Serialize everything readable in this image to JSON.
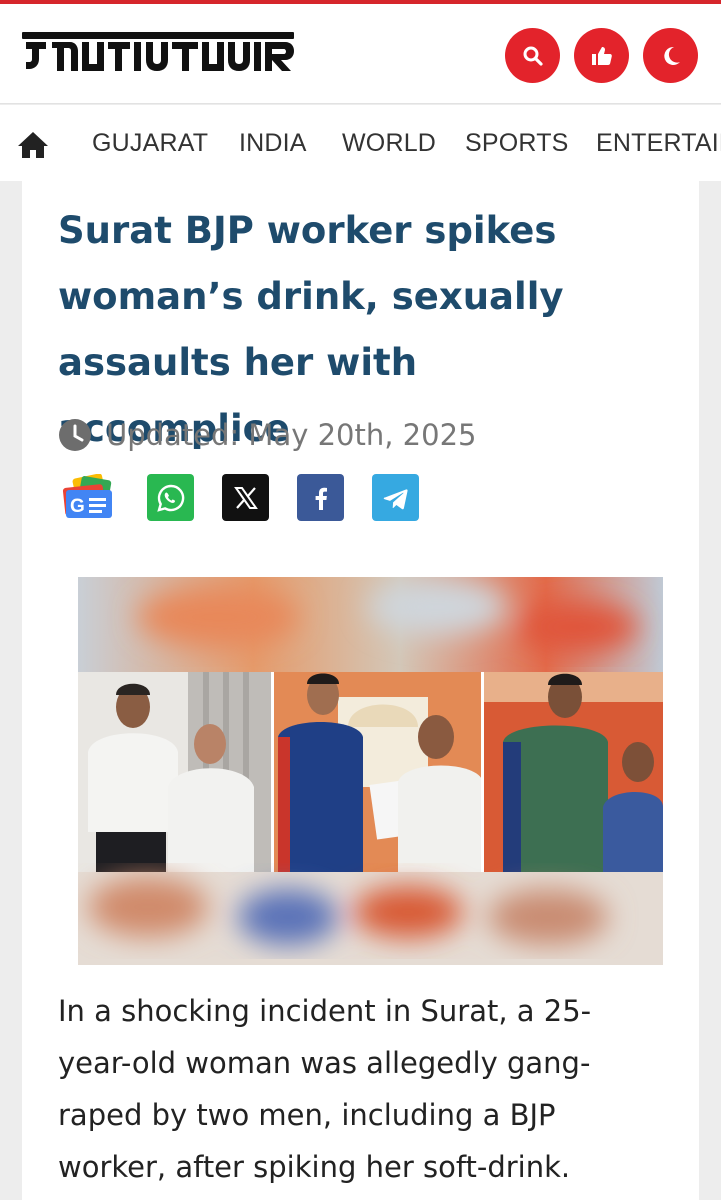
{
  "header": {
    "logo_text": "ગુજરાત સમાચાર",
    "search_icon": "search-icon",
    "like_icon": "thumbs-up-icon",
    "dark_mode_icon": "moon-icon",
    "accent_color": "#e3232b"
  },
  "nav": {
    "home_icon": "home-icon",
    "items": [
      "GUJARAT",
      "INDIA",
      "WORLD",
      "SPORTS",
      "ENTERTAIN"
    ]
  },
  "article": {
    "headline": "Surat BJP worker spikes woman’s drink, sexually assaults her with accomplice",
    "updated": "Updated: May 20th, 2025",
    "share": [
      {
        "name": "google-news",
        "icon": "google-news-icon",
        "color": "#4285f4"
      },
      {
        "name": "whatsapp",
        "icon": "whatsapp-icon",
        "color": "#29b851"
      },
      {
        "name": "x",
        "icon": "x-icon",
        "color": "#111111"
      },
      {
        "name": "facebook",
        "icon": "facebook-icon",
        "color": "#3b5998"
      },
      {
        "name": "telegram",
        "icon": "telegram-icon",
        "color": "#36a9e1"
      }
    ],
    "body": "In a shocking incident in Surat, a 25-year-old woman was allegedly gang-raped by two men, including a BJP worker, after spiking her soft-drink."
  },
  "colors": {
    "headline": "#1e4b6c",
    "meta": "#777777",
    "body": "#222222"
  }
}
